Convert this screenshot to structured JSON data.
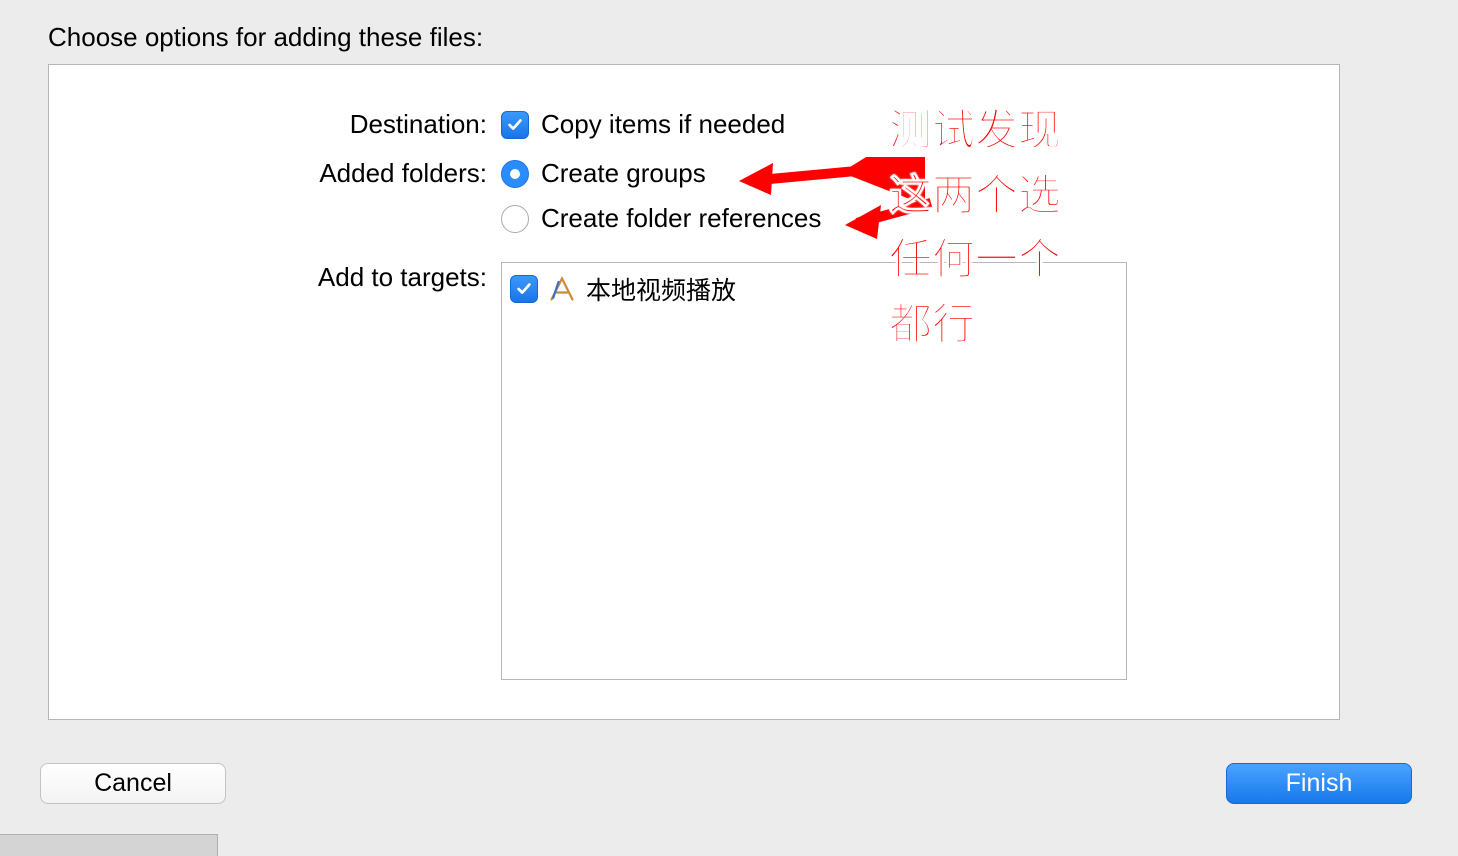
{
  "title": "Choose options for adding these files:",
  "destination": {
    "label": "Destination:",
    "copy_if_needed": "Copy items if needed",
    "copy_checked": true
  },
  "added_folders": {
    "label": "Added folders:",
    "create_groups": "Create groups",
    "create_folder_refs": "Create folder references",
    "selected": "groups"
  },
  "add_to_targets": {
    "label": "Add to targets:",
    "items": [
      {
        "name": "本地视频播放",
        "checked": true
      }
    ]
  },
  "annotation_lines": [
    "测试发现",
    "这两个选",
    "任何一个",
    "都行"
  ],
  "buttons": {
    "cancel": "Cancel",
    "finish": "Finish"
  }
}
